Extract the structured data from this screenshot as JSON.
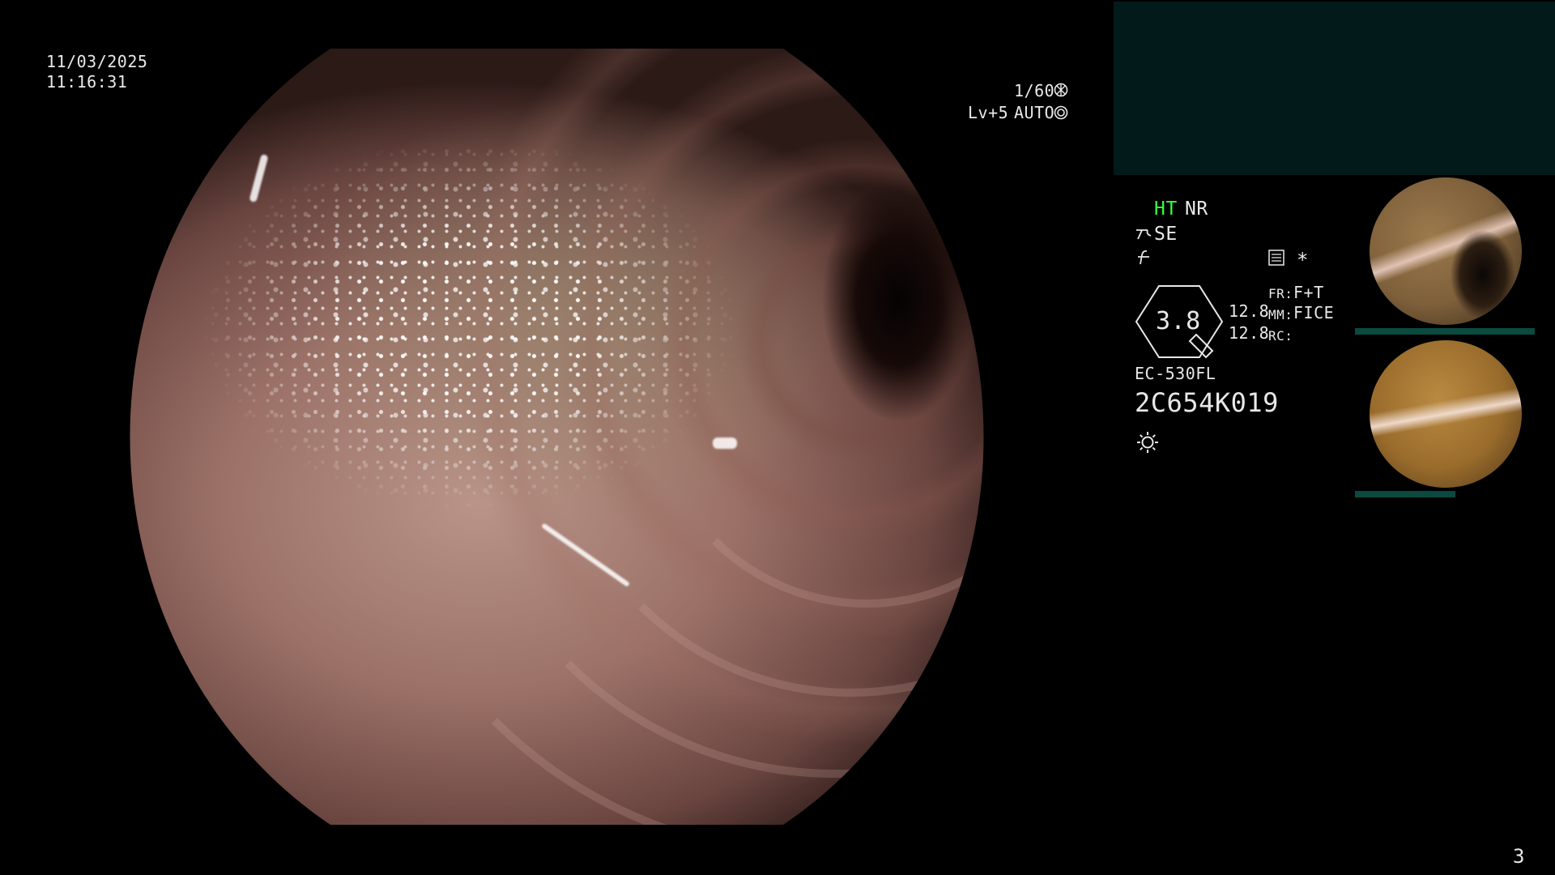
{
  "datetime": {
    "date": "11/03/2025",
    "time": "11:16:31"
  },
  "shutter": {
    "value": "1/60"
  },
  "level": {
    "value": "Lv+5",
    "mode": "AUTO"
  },
  "panel": {
    "ht": "HT",
    "nr": "NR",
    "se": "SE",
    "zoom": "3.8",
    "values": [
      "12.8",
      "12.8"
    ],
    "labels": [
      "FR:",
      "MM:",
      "RC:"
    ],
    "modes": [
      "F+T",
      "FICE"
    ],
    "asterisk": "*",
    "scope_model": "EC-530FL",
    "serial": "2C654K019"
  },
  "page_number": "3",
  "colors": {
    "ht_green": "#35ff3d",
    "teal_panel": "#021b1a",
    "thumb_bar": "#0b4a3f"
  },
  "icons": [
    "shutter-icon",
    "auto-iris-icon",
    "structure-enhance-icon",
    "sharpness-icon",
    "memo-icon",
    "scope-angle-icon",
    "light-icon"
  ]
}
